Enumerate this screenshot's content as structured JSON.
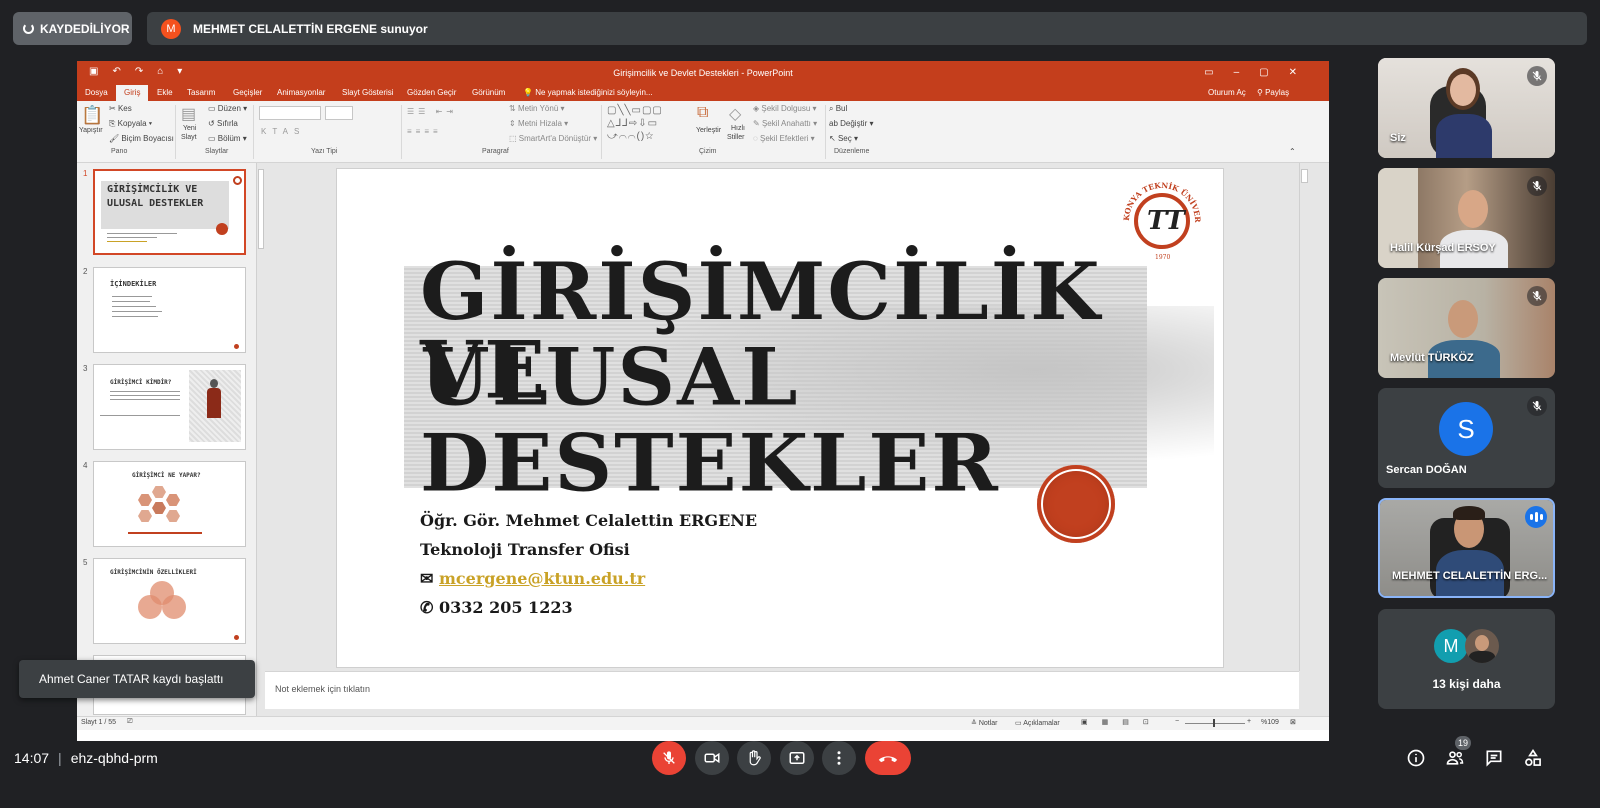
{
  "meet": {
    "recording_label": "KAYDEDİLİYOR",
    "presenter_initial": "M",
    "presenter_text": "MEHMET CELALETTİN ERGENE sunuyor",
    "time": "14:07",
    "meeting_code": "ehz-qbhd-prm",
    "participants_count": "19",
    "toast": "Ahmet Caner TATAR kaydı başlattı",
    "more_people": "13 kişi daha"
  },
  "participants": [
    {
      "name": "Siz"
    },
    {
      "name": "Halil Kürşad ERSOY"
    },
    {
      "name": "Mevlüt TÜRKÖZ"
    },
    {
      "name": "Sercan DOĞAN",
      "initial": "S"
    },
    {
      "name": "MEHMET CELALETTİN ERG..."
    }
  ],
  "more_avatar_initial": "M",
  "colors": {
    "accent_red": "#ea4335",
    "ppt_orange": "#c43e1c",
    "avatar_blue": "#1a73e8",
    "avatar_teal": "#129eaf"
  },
  "ppt": {
    "window_title": "Girişimcilik ve Devlet Destekleri - PowerPoint",
    "tabs": [
      "Dosya",
      "Giriş",
      "Ekle",
      "Tasarım",
      "Geçişler",
      "Animasyonlar",
      "Slayt Gösterisi",
      "Gözden Geçir",
      "Görünüm"
    ],
    "tell_me": "Ne yapmak istediğinizi söyleyin...",
    "signin": "Oturum Aç",
    "share": "Paylaş",
    "ribbon": {
      "paste": "Yapıştır",
      "cut": "Kes",
      "copy": "Kopyala",
      "format_painter": "Biçim Boyacısı",
      "new_slide_1": "Yeni",
      "new_slide_2": "Slayt",
      "layout": "Düzen",
      "reset": "Sıfırla",
      "section": "Bölüm",
      "text_direction": "Metin Yönü",
      "align_text": "Metni Hizala",
      "smartart": "SmartArt'a Dönüştür",
      "arrange": "Yerleştir",
      "quick_styles_1": "Hızlı",
      "quick_styles_2": "Stiller",
      "shape_fill": "Şekil Dolgusu",
      "shape_outline": "Şekil Anahattı",
      "shape_effects": "Şekil Efektleri",
      "find": "Bul",
      "replace": "Değiştir",
      "select": "Seç",
      "groups": [
        "Pano",
        "Slaytlar",
        "Yazı Tipi",
        "Paragraf",
        "Çizim",
        "Düzenleme"
      ]
    },
    "thumbnails": [
      {
        "num": "1",
        "title": "GİRİŞİMCİLİK VE ULUSAL DESTEKLER"
      },
      {
        "num": "2",
        "title": "İÇİNDEKİLER"
      },
      {
        "num": "3",
        "title": "GİRİŞİMCİ KİMDİR?"
      },
      {
        "num": "4",
        "title": "GİRİŞİMCİ NE YAPAR?"
      },
      {
        "num": "5",
        "title": "GİRİŞİMCİNİN ÖZELLİKLERİ"
      }
    ],
    "slide": {
      "title_line1": "GİRİŞİMCİLİK VE",
      "title_line2": "ULUSAL",
      "title_line3": "DESTEKLER",
      "presenter": "Öğr. Gör. Mehmet Celalettin ERGENE",
      "office": "Teknoloji Transfer Ofisi",
      "email": "mcergene@ktun.edu.tr",
      "phone": "0332 205 1223",
      "logo_text": "KONYA TEKNİK ÜNİVERSİTESİ",
      "logo_year": "1970"
    },
    "notes_placeholder": "Not eklemek için tıklatın",
    "status": {
      "slide_of": "Slayt 1 / 55",
      "notes": "Notlar",
      "comments": "Açıklamalar",
      "zoom": "%109"
    }
  }
}
